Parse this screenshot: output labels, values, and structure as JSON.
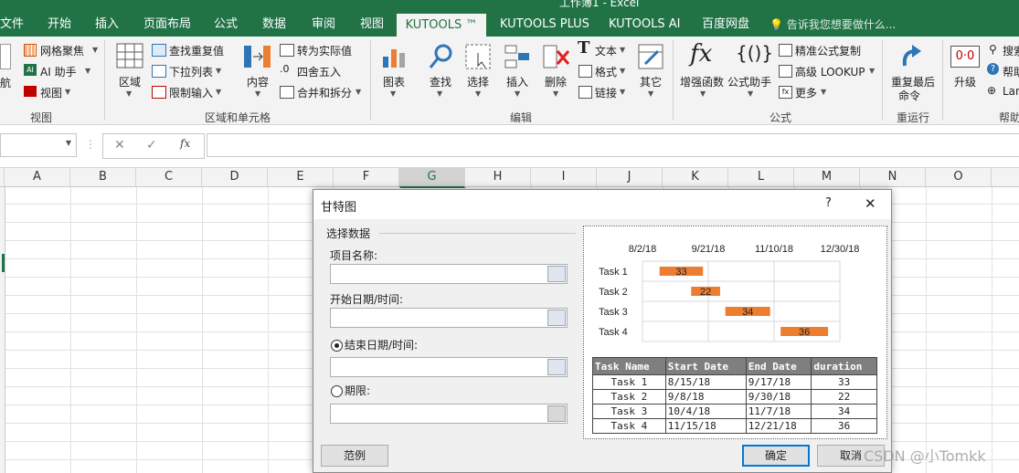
{
  "window": {
    "title": "工作簿1 - Excel"
  },
  "tabs": [
    "文件",
    "开始",
    "插入",
    "页面布局",
    "公式",
    "数据",
    "审阅",
    "视图",
    "KUTOOLS ™",
    "KUTOOLS PLUS",
    "KUTOOLS AI",
    "百度网盘"
  ],
  "tell_me": "告诉我您想要做什么...",
  "ribbon": {
    "nav_label": "航",
    "view_group": {
      "items": [
        "网格聚焦",
        "AI 助手",
        "视图"
      ],
      "title": "视图"
    },
    "range_group": {
      "region": "区域",
      "col2": [
        "查找重复值",
        "下拉列表",
        "限制输入"
      ],
      "content": "内容",
      "col3": [
        "转为实际值",
        "四舍五入",
        "合并和拆分"
      ],
      "title": "区域和单元格"
    },
    "edit_group": {
      "big": [
        "图表",
        "查找",
        "选择",
        "插入",
        "删除"
      ],
      "small": [
        "文本",
        "格式",
        "链接"
      ],
      "other": "其它",
      "title": "编辑"
    },
    "formula_group": {
      "big": [
        "增强函数",
        "公式助手"
      ],
      "small": [
        "精准公式复制",
        "高级 LOOKUP",
        "更多"
      ],
      "title": "公式"
    },
    "rerun_group": {
      "label1": "重复最后",
      "label2": "命令",
      "title": "重运行"
    },
    "upgrade": "升级",
    "help_group": {
      "items": [
        "搜索",
        "帮助",
        "Lang"
      ],
      "title": "帮助"
    }
  },
  "columns": [
    "A",
    "B",
    "C",
    "D",
    "E",
    "F",
    "G",
    "H",
    "I",
    "J",
    "K",
    "L",
    "M",
    "N",
    "O"
  ],
  "dialog": {
    "title": "甘特图",
    "help": "?",
    "close": "✕",
    "section": "选择数据",
    "task_name_label": "项目名称:",
    "start_label": "开始日期/时间:",
    "end_label": "结束日期/时间:",
    "duration_label": "期限:",
    "example_button": "范例",
    "ok_button": "确定",
    "cancel_button": "取消"
  },
  "chart_data": {
    "type": "bar",
    "x_ticks": [
      "8/2/18",
      "9/21/18",
      "11/10/18",
      "12/30/18"
    ],
    "categories": [
      "Task 1",
      "Task 2",
      "Task 3",
      "Task 4"
    ],
    "series": [
      {
        "values": [
          33,
          22,
          34,
          36
        ]
      }
    ],
    "start_dates": [
      "8/15/18",
      "9/8/18",
      "10/4/18",
      "11/15/18"
    ],
    "end_dates": [
      "9/17/18",
      "9/30/18",
      "11/7/18",
      "12/21/18"
    ],
    "bar_color": "#ed7d31",
    "grid": true
  },
  "table": {
    "headers": [
      "Task Name",
      "Start Date",
      "End Date",
      "duration"
    ],
    "rows": [
      [
        "Task 1",
        "8/15/18",
        "9/17/18",
        "33"
      ],
      [
        "Task 2",
        "9/8/18",
        "9/30/18",
        "22"
      ],
      [
        "Task 3",
        "10/4/18",
        "11/7/18",
        "34"
      ],
      [
        "Task 4",
        "11/15/18",
        "12/21/18",
        "36"
      ]
    ]
  },
  "colors": {
    "excel_green": "#217346",
    "ribbon_bg": "#f3f3f3",
    "header_gray": "#7f7f7f"
  },
  "watermark": "CSDN @小Tomkk"
}
